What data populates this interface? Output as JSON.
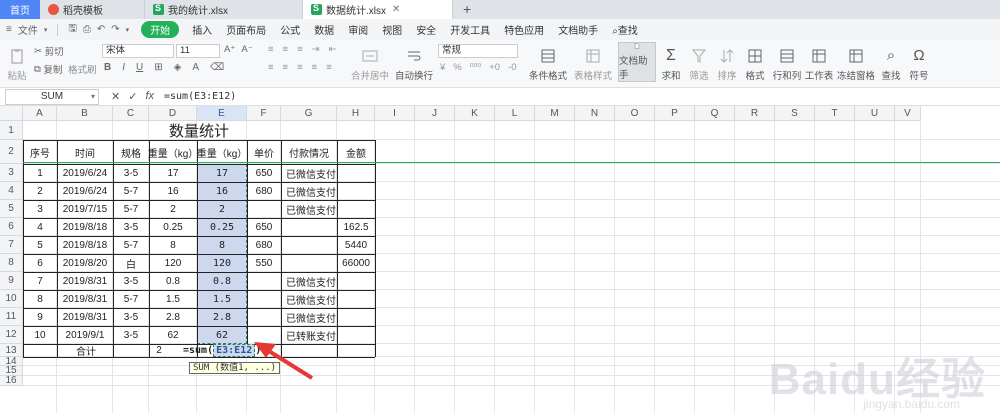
{
  "tabs": [
    {
      "label": "首页",
      "kind": "home"
    },
    {
      "label": "稻壳模板",
      "kind": "orange"
    },
    {
      "label": "我的统计.xlsx",
      "kind": "green"
    },
    {
      "label": "数据统计.xlsx",
      "kind": "green",
      "active": true
    }
  ],
  "menu": {
    "file": "文件",
    "items": [
      "开始",
      "插入",
      "页面布局",
      "公式",
      "数据",
      "审阅",
      "视图",
      "安全",
      "开发工具",
      "特色应用",
      "文档助手",
      "查找"
    ]
  },
  "ribbon": {
    "cut": "剪切",
    "copy": "复制",
    "paste": "粘贴",
    "format_painter": "格式刷",
    "font_name": "宋体",
    "font_size": "11",
    "number_format": "常规",
    "merge": "合并居中",
    "wrap": "自动换行",
    "cond_format": "条件格式",
    "table_style": "表格样式",
    "doc_assist": "文档助手",
    "sum": "求和",
    "filter": "筛选",
    "sort": "排序",
    "format": "格式",
    "rowcol": "行和列",
    "sheet": "工作表",
    "freeze": "冻结窗格",
    "find": "查找",
    "symbol": "符号",
    "fx_label": "fx"
  },
  "formula_bar": {
    "name_box": "SUM",
    "formula": "=sum(E3:E12)"
  },
  "columns": [
    "A",
    "B",
    "C",
    "D",
    "E",
    "F",
    "G",
    "H",
    "I",
    "J",
    "K",
    "L",
    "M",
    "N",
    "O",
    "P",
    "Q",
    "R",
    "S",
    "T",
    "U",
    "V"
  ],
  "rows": [
    "1",
    "2",
    "3",
    "4",
    "5",
    "6",
    "7",
    "8",
    "9",
    "10",
    "11",
    "12",
    "13",
    "14",
    "15",
    "16"
  ],
  "table": {
    "title": "数量统计",
    "headers": [
      "序号",
      "时间",
      "规格",
      "重量（kg）",
      "重量（kg）",
      "单价",
      "付款情况",
      "金额"
    ],
    "rows": [
      [
        "1",
        "2019/6/24",
        "3-5",
        "17",
        "17",
        "650",
        "已微信支付",
        ""
      ],
      [
        "2",
        "2019/6/24",
        "5-7",
        "16",
        "16",
        "680",
        "已微信支付",
        ""
      ],
      [
        "3",
        "2019/7/15",
        "5-7",
        "2",
        "2",
        "",
        "已微信支付",
        ""
      ],
      [
        "4",
        "2019/8/18",
        "3-5",
        "0.25",
        "0.25",
        "650",
        "",
        "162.5"
      ],
      [
        "5",
        "2019/8/18",
        "5-7",
        "8",
        "8",
        "680",
        "",
        "5440"
      ],
      [
        "6",
        "2019/8/20",
        "白",
        "120",
        "120",
        "550",
        "",
        "66000"
      ],
      [
        "7",
        "2019/8/31",
        "3-5",
        "0.8",
        "0.8",
        "",
        "已微信支付",
        ""
      ],
      [
        "8",
        "2019/8/31",
        "5-7",
        "1.5",
        "1.5",
        "",
        "已微信支付",
        ""
      ],
      [
        "9",
        "2019/8/31",
        "3-5",
        "2.8",
        "2.8",
        "",
        "已微信支付",
        ""
      ],
      [
        "10",
        "2019/9/1",
        "3-5",
        "62",
        "62",
        "",
        "已转账支付",
        ""
      ]
    ],
    "total_label": "合计",
    "total_d": "2",
    "editing_cell": "=sum(",
    "editing_ref": "E3:E12",
    "editing_close": ")",
    "tooltip": "SUM (数值1, ...)"
  },
  "watermark": "Baidu经验",
  "watermark_sub": "jingyan.baidu.com",
  "colors": {
    "accent": "#25b05a",
    "selection": "#cdd8ef",
    "arrow": "#e53935"
  }
}
